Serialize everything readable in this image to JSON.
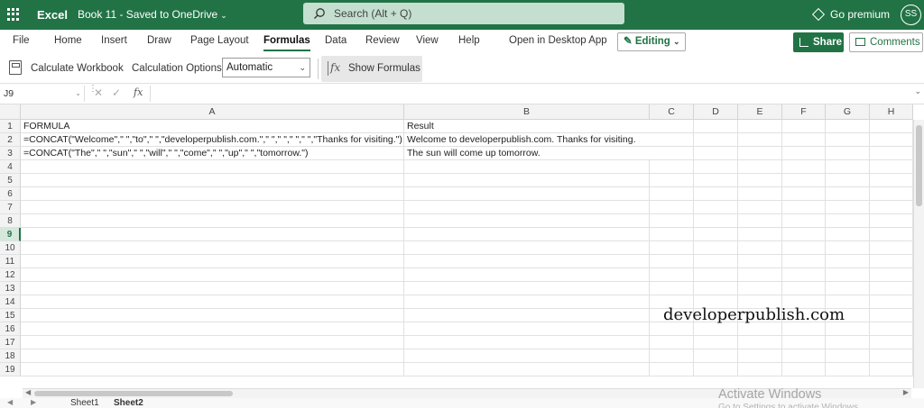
{
  "titlebar": {
    "app_name": "Excel",
    "book_title": "Book 11 - Saved to OneDrive",
    "search_placeholder": "Search (Alt + Q)",
    "premium": "Go premium",
    "avatar_initials": "SS"
  },
  "tabs": [
    {
      "label": "File"
    },
    {
      "label": "Home"
    },
    {
      "label": "Insert"
    },
    {
      "label": "Draw"
    },
    {
      "label": "Page Layout"
    },
    {
      "label": "Formulas"
    },
    {
      "label": "Data"
    },
    {
      "label": "Review"
    },
    {
      "label": "View"
    },
    {
      "label": "Help"
    },
    {
      "label": "Open in Desktop App"
    }
  ],
  "active_tab": "Formulas",
  "editing_label": "Editing",
  "share_label": "Share",
  "comments_label": "Comments",
  "ribbon": {
    "calculate_workbook": "Calculate Workbook",
    "calc_options_label": "Calculation Options",
    "calc_options_value": "Automatic",
    "show_formulas": "Show Formulas"
  },
  "formula_bar": {
    "name_box": "J9",
    "fx": "fx",
    "content": ""
  },
  "columns": [
    "A",
    "B",
    "C",
    "D",
    "E",
    "F",
    "G",
    "H"
  ],
  "rows": [
    "1",
    "2",
    "3",
    "4",
    "5",
    "6",
    "7",
    "8",
    "9",
    "10",
    "11",
    "12",
    "13",
    "14",
    "15",
    "16",
    "17",
    "18",
    "19"
  ],
  "selected_row": "9",
  "cells": {
    "A1": "FORMULA",
    "B1": "Result",
    "A2": "=CONCAT(\"Welcome\",\" \",\"to\",\" \",\"developerpublish.com.\",\" \",\" \",\" \",\" \",\"Thanks for visiting.\")",
    "B2": "Welcome to developerpublish.com.    Thanks for visiting.",
    "A3": "=CONCAT(\"The\",\" \",\"sun\",\" \",\"will\",\" \",\"come\",\" \",\"up\",\" \",\"tomorrow.\")",
    "B3": "The sun will come up tomorrow."
  },
  "watermark": "developerpublish.com",
  "sheets": [
    {
      "label": "Sheet1"
    },
    {
      "label": "Sheet2"
    }
  ],
  "active_sheet": "Sheet2",
  "activate_windows": "Activate Windows",
  "activate_windows_sub": "Go to Settings to activate Windows."
}
